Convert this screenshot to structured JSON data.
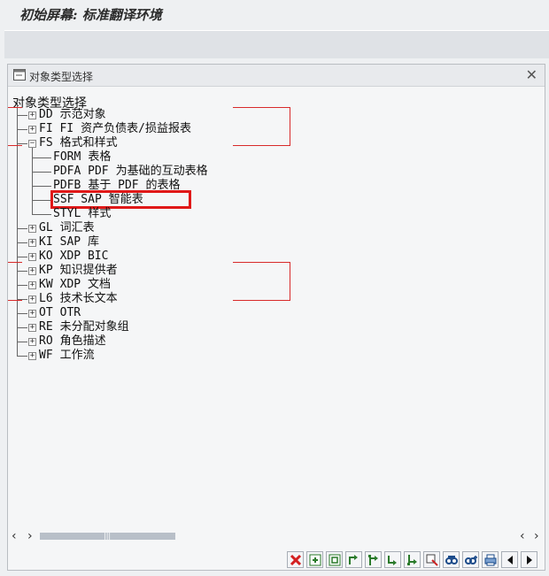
{
  "app": {
    "title": "初始屏幕: 标准翻译环境"
  },
  "dialog": {
    "title": "对象类型选择",
    "close_icon": "close-icon",
    "tree_root": "对象类型选择",
    "items": [
      {
        "code": "DD",
        "label": "示范对象",
        "expandable": true,
        "expanded": false,
        "level": 0
      },
      {
        "code": "FI FI",
        "label": "资产负债表/损益报表",
        "expandable": true,
        "expanded": false,
        "level": 0
      },
      {
        "code": "FS",
        "label": "格式和样式",
        "expandable": true,
        "expanded": true,
        "level": 0
      },
      {
        "code": "FORM",
        "label": "表格",
        "expandable": false,
        "level": 1
      },
      {
        "code": "PDFA PDF",
        "label": "为基础的互动表格",
        "expandable": false,
        "level": 1
      },
      {
        "code": "PDFB",
        "label": "基于 PDF 的表格",
        "expandable": false,
        "level": 1
      },
      {
        "code": "SSF  SAP",
        "label": "智能表",
        "expandable": false,
        "level": 1,
        "selected": true
      },
      {
        "code": "STYL",
        "label": "样式",
        "expandable": false,
        "level": 1
      },
      {
        "code": "GL",
        "label": "词汇表",
        "expandable": true,
        "expanded": false,
        "level": 0
      },
      {
        "code": "KI",
        "label": "SAP 库",
        "expandable": true,
        "expanded": false,
        "level": 0
      },
      {
        "code": "KO",
        "label": "XDP BIC",
        "expandable": true,
        "expanded": false,
        "level": 0
      },
      {
        "code": "KP",
        "label": "知识提供者",
        "expandable": true,
        "expanded": false,
        "level": 0
      },
      {
        "code": "KW",
        "label": "XDP 文档",
        "expandable": true,
        "expanded": false,
        "level": 0
      },
      {
        "code": "L6",
        "label": "技术长文本",
        "expandable": true,
        "expanded": false,
        "level": 0
      },
      {
        "code": "OT",
        "label": "OTR",
        "expandable": true,
        "expanded": false,
        "level": 0
      },
      {
        "code": "RE",
        "label": "未分配对象组",
        "expandable": true,
        "expanded": false,
        "level": 0
      },
      {
        "code": "RO",
        "label": "角色描述",
        "expandable": true,
        "expanded": false,
        "level": 0
      },
      {
        "code": "WF",
        "label": "工作流",
        "expandable": true,
        "expanded": false,
        "level": 0
      }
    ],
    "scrollbar": {
      "left_icon": "chevron-left-icon",
      "right_icon": "chevron-right-icon",
      "grip": "|||"
    },
    "toolbar_icons": [
      "cancel-icon",
      "add-node-icon",
      "collapse-node-icon",
      "expand-subtree-icon",
      "expand-all-icon",
      "collapse-subtree-icon",
      "collapse-all-icon",
      "select-icon",
      "find-icon",
      "find-next-icon",
      "print-icon",
      "previous-icon",
      "next-icon"
    ]
  },
  "colors": {
    "annotation": "#e01818",
    "background": "#eef0f2",
    "dialog_bg": "#f5f6f7"
  }
}
